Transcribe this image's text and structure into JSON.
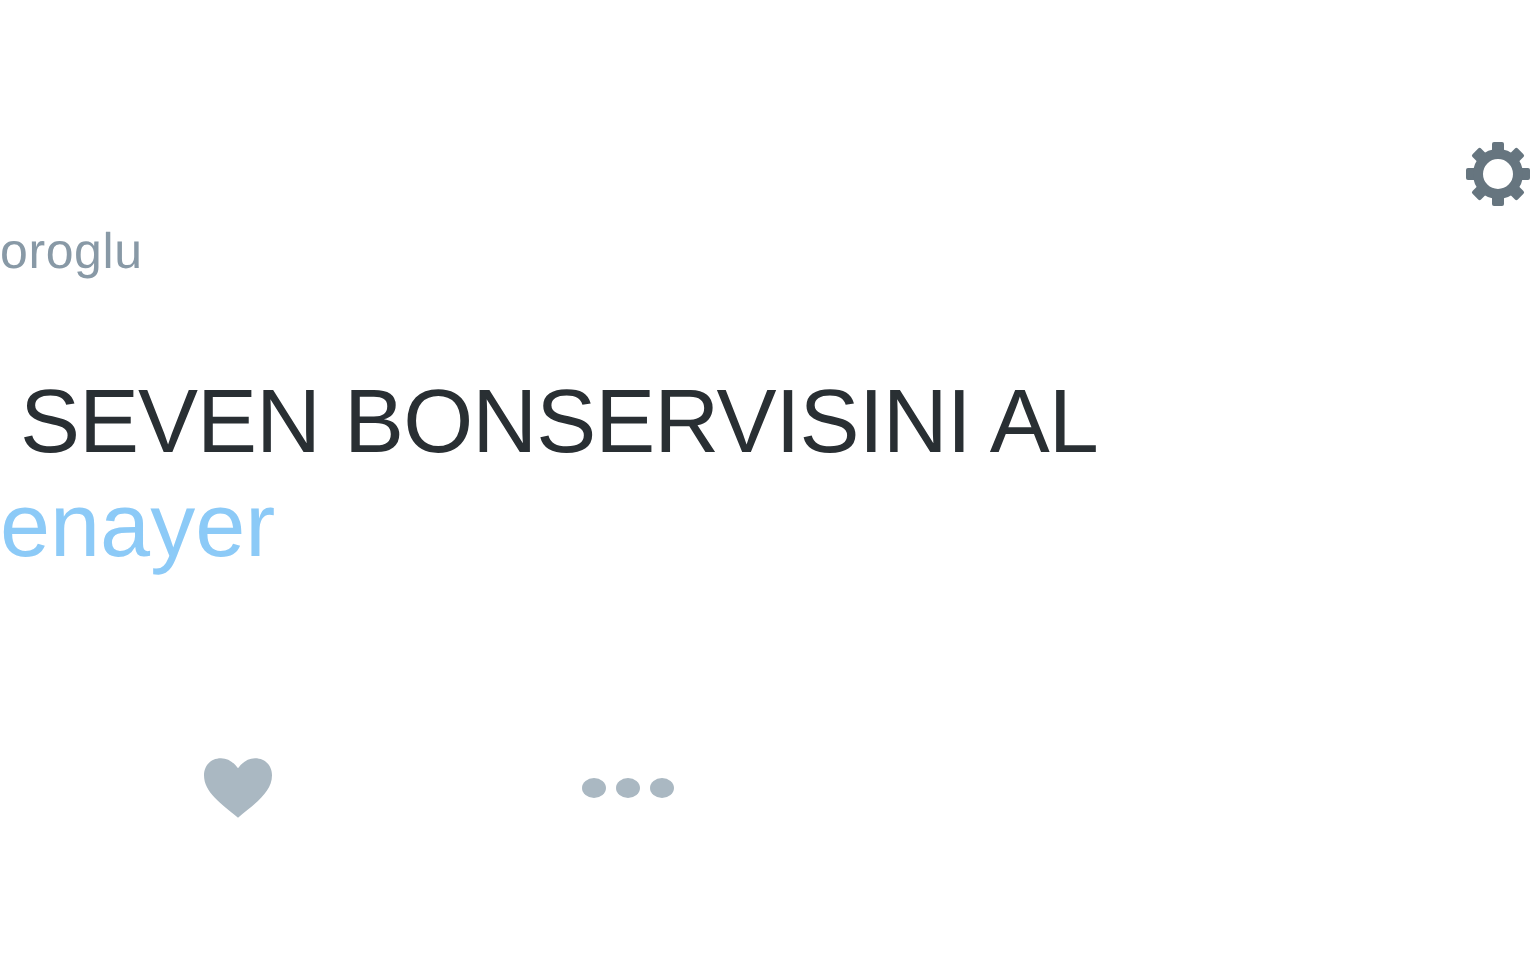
{
  "header": {
    "username": "oroglu"
  },
  "tweet": {
    "text": "SEVEN BONSERVISINI AL",
    "link": "enayer"
  },
  "actions": [
    {
      "kind": "like"
    },
    {
      "kind": "more"
    }
  ]
}
